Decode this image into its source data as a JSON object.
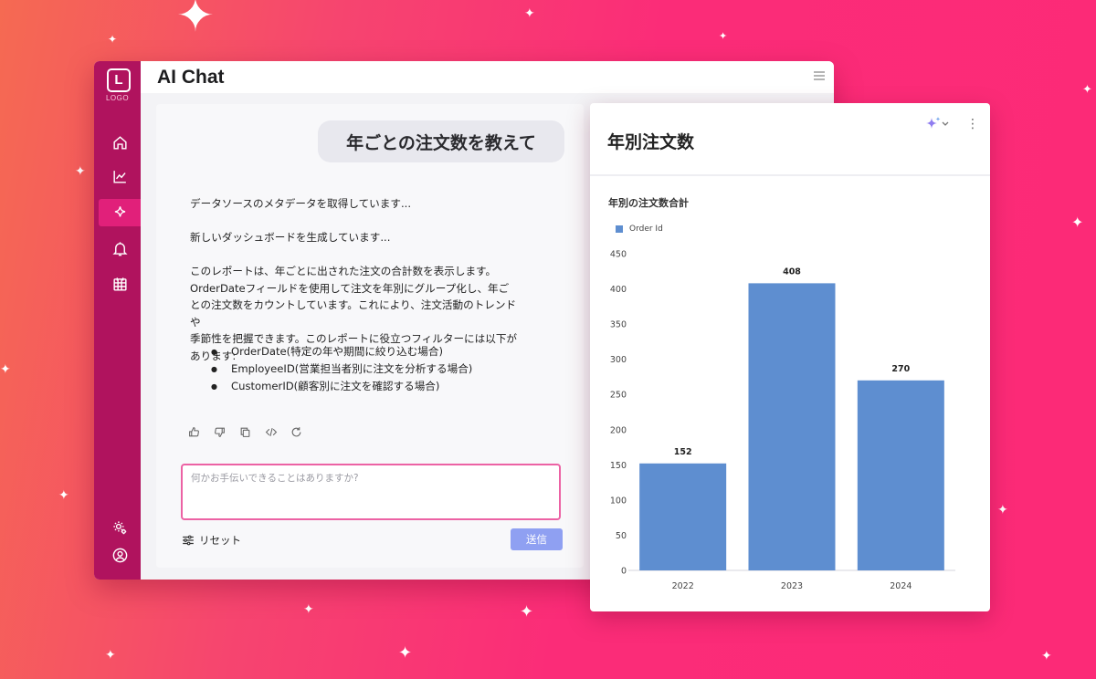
{
  "app": {
    "logo_letter": "L",
    "logo_text": "LOGO",
    "title": "AI Chat"
  },
  "sidebar": {
    "items": [
      {
        "icon": "home-icon"
      },
      {
        "icon": "chart-icon"
      },
      {
        "icon": "sparkle-icon",
        "active": true
      },
      {
        "icon": "bell-icon"
      },
      {
        "icon": "calendar-icon"
      }
    ],
    "bottom": [
      {
        "icon": "settings-icon"
      },
      {
        "icon": "user-icon"
      }
    ]
  },
  "chat": {
    "user_message": "年ごとの注文数を教えて",
    "status_1": "データソースのメタデータを取得しています...",
    "status_2": "新しいダッシュボードを生成しています...",
    "response_lines": [
      "このレポートは、年ごとに出された注文の合計数を表示します。",
      "OrderDateフィールドを使用して注文を年別にグループ化し、年ご",
      "との注文数をカウントしています。これにより、注文活動のトレンドや",
      "季節性を把握できます。このレポートに役立つフィルターには以下が",
      "あります:"
    ],
    "bullets": [
      "OrderDate(特定の年や期間に絞り込む場合)",
      "EmployeeID(営業担当者別に注文を分析する場合)",
      "CustomerID(顧客別に注文を確認する場合)"
    ],
    "actions": [
      "thumbs-up-icon",
      "thumbs-down-icon",
      "copy-icon",
      "code-icon",
      "refresh-icon"
    ],
    "input_placeholder": "何かお手伝いできることはありますか?",
    "input_value": "",
    "reset_label": "リセット",
    "send_label": "送信"
  },
  "card": {
    "title": "年別注文数"
  },
  "colors": {
    "sidebar": "#b0135e",
    "accent": "#e1207a",
    "bar": "#5e8ed0",
    "send_button": "#8fa0f2"
  },
  "chart_data": {
    "type": "bar",
    "title": "年別の注文数合計",
    "categories": [
      "2022",
      "2023",
      "2024"
    ],
    "series": [
      {
        "name": "Order Id",
        "values": [
          152,
          408,
          270
        ]
      }
    ],
    "ylim": [
      0,
      450
    ],
    "yticks": [
      0,
      50,
      100,
      150,
      200,
      250,
      300,
      350,
      400,
      450
    ],
    "legend": "top-left",
    "grid": false
  }
}
